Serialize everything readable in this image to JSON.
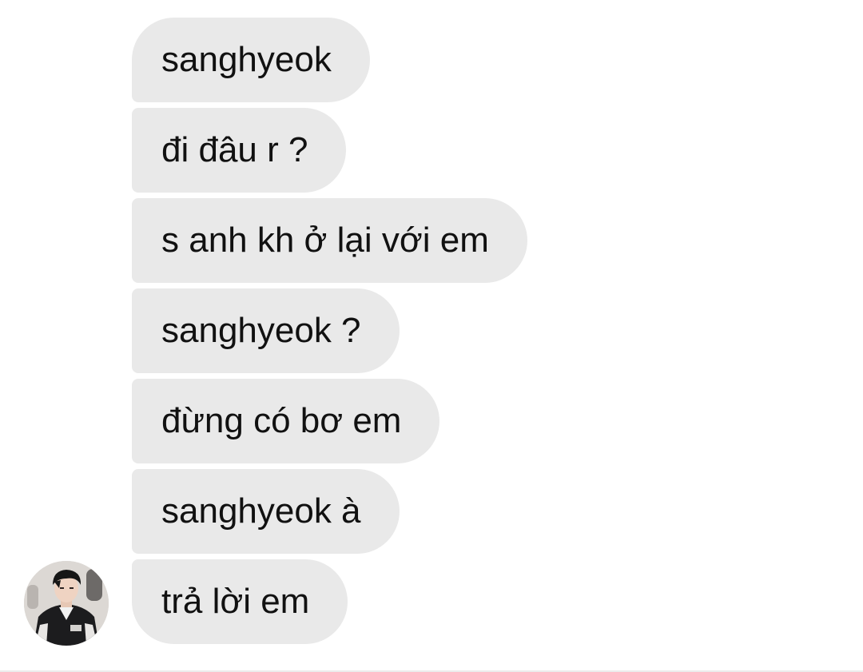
{
  "thread": {
    "messages": [
      {
        "text": "sanghyeok"
      },
      {
        "text": "đi đâu r ?"
      },
      {
        "text": "s anh kh ở lại với em"
      },
      {
        "text": "sanghyeok ?"
      },
      {
        "text": "đừng có bơ em"
      },
      {
        "text": "sanghyeok à"
      },
      {
        "text": "trả lời em"
      }
    ]
  },
  "avatar": {
    "icon": "profile-photo-icon"
  },
  "colors": {
    "bubble": "#e9e9e9",
    "text": "#111111",
    "background": "#ffffff"
  }
}
